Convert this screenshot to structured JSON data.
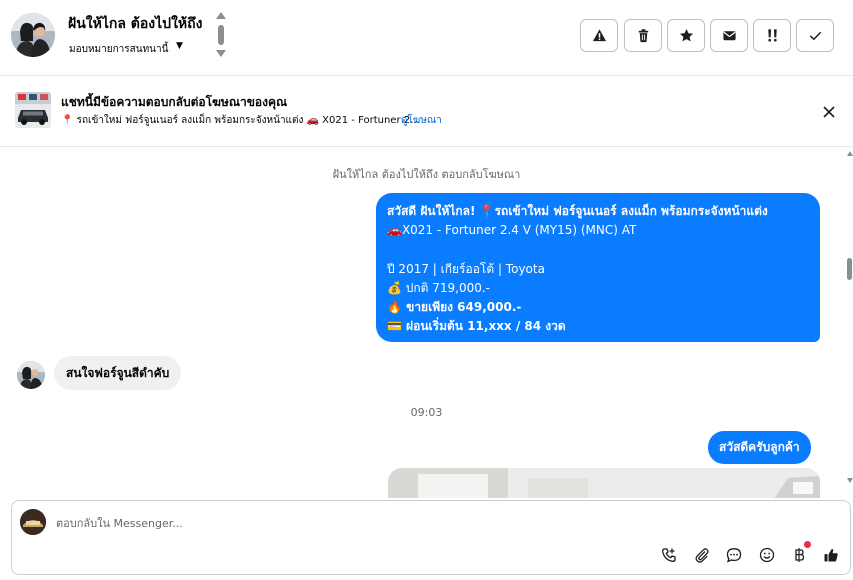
{
  "header": {
    "name": "ฝันให้ไกล ต้องไปให้ถึง",
    "subtitle": "มอบหมายการสนทนานี้",
    "buttons": [
      {
        "name": "report-button",
        "icon": "warning-icon"
      },
      {
        "name": "delete-button",
        "icon": "trash-icon"
      },
      {
        "name": "star-button",
        "icon": "star-icon"
      },
      {
        "name": "mark-unread-button",
        "icon": "envelope-icon"
      },
      {
        "name": "follow-up-button",
        "icon": "exclamation-icon"
      },
      {
        "name": "done-button",
        "icon": "checkmark-icon"
      }
    ]
  },
  "ad": {
    "title": "แชทนี้มีข้อความตอบกลับต่อโฆษณาของคุณ",
    "text": "📍 รถเข้าใหม่ ฟอร์จูนเนอร์ ลงแม็ก พร้อมกระจังหน้าแต่ง 🚗 X021 - Fortuner 2...",
    "link": "ดูโฆษณา"
  },
  "messages": {
    "system_note": "ฝันให้ไกล ต้องไปให้ถึง ตอบกลับโฆษณา",
    "outgoing_1": {
      "line1": "สวัสดี ฝันให้ไกล! 📍รถเข้าใหม่ ฟอร์จูนเนอร์ ลงแม็ก พร้อมกระจังหน้าแต่ง",
      "line2": "🚗X021 - Fortuner 2.4 V (MY15) (MNC) AT",
      "line3": "ปี 2017 | เกียร์ออโต้ | Toyota",
      "line4": "💰 ปกติ 719,000.-",
      "line5": "🔥 ขายเพียง 649,000.-",
      "line6": "💳 ผ่อนเริ่มต้น 11,xxx / 84 งวด"
    },
    "incoming_1": "สนใจฟอร์จูนสีดำคับ",
    "time_separator": "09:03",
    "outgoing_2": "สวัสดีครับลูกค้า"
  },
  "composer": {
    "placeholder": "ตอบกลับใน Messenger...",
    "tools": [
      "phone-add-icon",
      "paperclip-icon",
      "chat-bubble-icon",
      "smiley-icon",
      "baht-icon",
      "thumbs-up-icon"
    ]
  },
  "colors": {
    "accent": "#0a7cff",
    "incoming_bubble": "#f0f0f0",
    "link": "#0064d1",
    "badge": "#f02849"
  }
}
